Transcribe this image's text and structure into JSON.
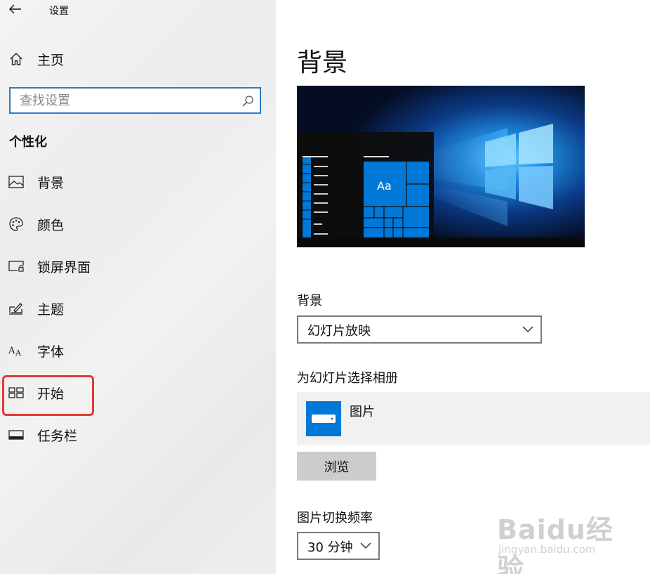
{
  "window": {
    "title": "设置"
  },
  "sidebar": {
    "home_label": "主页",
    "search_placeholder": "查找设置",
    "section_heading": "个性化",
    "items": [
      {
        "label": "背景",
        "icon": "picture-icon"
      },
      {
        "label": "颜色",
        "icon": "palette-icon"
      },
      {
        "label": "锁屏界面",
        "icon": "lock-screen-icon"
      },
      {
        "label": "主题",
        "icon": "theme-icon"
      },
      {
        "label": "字体",
        "icon": "font-icon"
      },
      {
        "label": "开始",
        "icon": "start-icon"
      },
      {
        "label": "任务栏",
        "icon": "taskbar-icon"
      }
    ],
    "highlighted_item": "开始"
  },
  "main": {
    "title": "背景",
    "preview_tile_text": "Aa",
    "background_label": "背景",
    "background_value": "幻灯片放映",
    "album_label": "为幻灯片选择相册",
    "album_name": "图片",
    "browse_label": "浏览",
    "interval_label": "图片切换频率",
    "interval_value": "30 分钟"
  },
  "watermark": {
    "brand": "Baidu经验",
    "url": "jingyan.baidu.com"
  },
  "colors": {
    "accent": "#0078d7",
    "search_border": "#2b7bc7",
    "highlight": "#e53935",
    "button_bg": "#cccccc",
    "album_row_bg": "#f1f1f1"
  }
}
